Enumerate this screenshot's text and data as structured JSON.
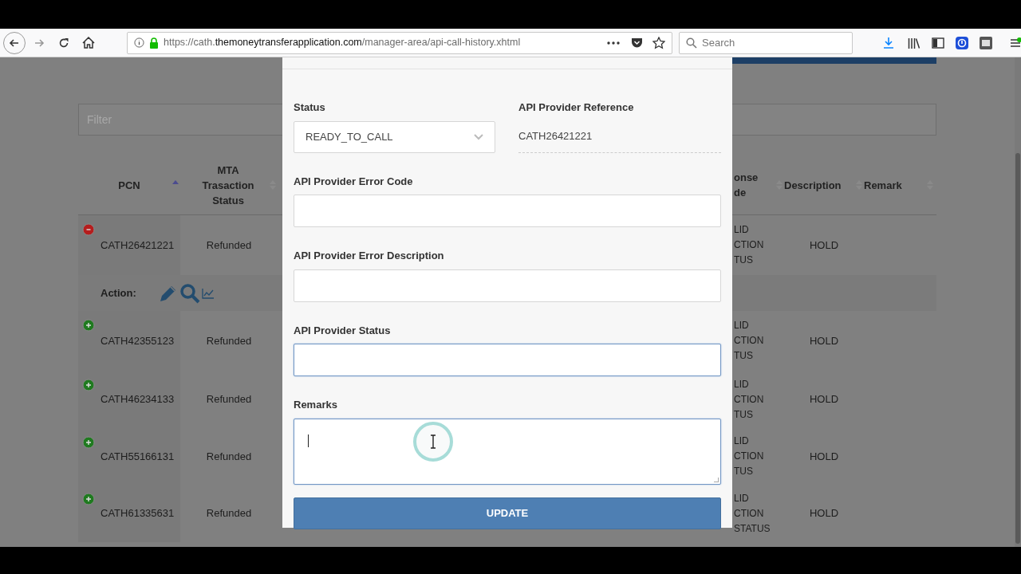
{
  "browser": {
    "url": [
      {
        "text": "https://cath.",
        "emphasized": false
      },
      {
        "text": "themoneytransferapplication.com",
        "emphasized": true
      },
      {
        "text": "/manager-area/api-call-history.xhtml",
        "emphasized": false
      }
    ],
    "search": {
      "placeholder": "Search"
    }
  },
  "page": {
    "filter": {
      "placeholder": "Filter"
    },
    "table": {
      "columns": [
        {
          "label": "PCN",
          "sorted": true
        },
        {
          "label": "MTA Trasaction Status",
          "sorted": false
        },
        {
          "label": "onse de",
          "sorted": false
        },
        {
          "label": "Description",
          "sorted": false
        },
        {
          "label": "Remark",
          "sorted": false
        }
      ],
      "rows": [
        {
          "pcn": "CATH26421221",
          "mta_status": "Refunded",
          "column_3": [
            "LID",
            "CTION",
            "TUS"
          ],
          "description": "HOLD",
          "expanded": true,
          "action_label": "Action:"
        },
        {
          "pcn": "CATH42355123",
          "mta_status": "Refunded",
          "column_3": [
            "LID",
            "CTION",
            "TUS"
          ],
          "description": "HOLD",
          "expanded": false
        },
        {
          "pcn": "CATH46234133",
          "mta_status": "Refunded",
          "column_3": [
            "LID",
            "CTION",
            "TUS"
          ],
          "description": "HOLD",
          "expanded": false
        },
        {
          "pcn": "CATH55166131",
          "mta_status": "Refunded",
          "column_3": [
            "LID",
            "CTION",
            "TUS"
          ],
          "description": "HOLD",
          "expanded": false
        },
        {
          "pcn": "CATH61335631",
          "mta_status": "Refunded",
          "column_3": [
            "LID",
            "CTION",
            "STATUS"
          ],
          "description": "HOLD",
          "expanded": false
        }
      ]
    }
  },
  "modal": {
    "status": {
      "label": "Status",
      "value": "READY_TO_CALL"
    },
    "reference": {
      "label": "API Provider Reference",
      "value": "CATH26421221"
    },
    "fields": [
      {
        "label": "API Provider Error Code",
        "kind": "input",
        "focused": false
      },
      {
        "label": "API Provider Error Description",
        "kind": "input",
        "focused": false
      },
      {
        "label": "API Provider Status",
        "kind": "input",
        "focused": true
      },
      {
        "label": "Remarks",
        "kind": "textarea",
        "focused": true
      }
    ],
    "button": "UPDATE"
  }
}
